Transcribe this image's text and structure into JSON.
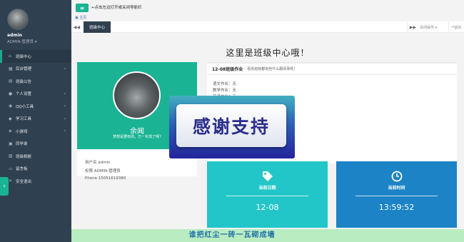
{
  "user": {
    "name": "admin",
    "role": "ADMIN-管理员"
  },
  "sidebar": {
    "items": [
      {
        "label": "班级中心",
        "icon": "home-icon",
        "glyph": "⌂",
        "caret": ""
      },
      {
        "label": "后台管理",
        "icon": "grid-icon",
        "glyph": "▦",
        "caret": "‹"
      },
      {
        "label": "班级公告",
        "icon": "bell-icon",
        "glyph": "▤",
        "caret": ""
      },
      {
        "label": "个人设置",
        "icon": "user-icon",
        "glyph": "●",
        "caret": "‹"
      },
      {
        "label": "QQ小工具",
        "icon": "qq-icon",
        "glyph": "◉",
        "caret": "‹"
      },
      {
        "label": "学习工具",
        "icon": "graduation-cap-icon",
        "glyph": "◆",
        "caret": "‹"
      },
      {
        "label": "小游戏",
        "icon": "gamepad-icon",
        "glyph": "◈",
        "caret": "‹"
      },
      {
        "label": "同学录",
        "icon": "book-icon",
        "glyph": "▣",
        "caret": ""
      },
      {
        "label": "班级相册",
        "icon": "image-icon",
        "glyph": "▨",
        "caret": ""
      },
      {
        "label": "留言板",
        "icon": "comment-icon",
        "glyph": "▭",
        "caret": ""
      },
      {
        "label": "安全退出",
        "icon": "close-icon",
        "glyph": "✕",
        "caret": ""
      }
    ]
  },
  "topbar": {
    "menu_hint": "←点击左边打开或关闭导航栏",
    "home_crumb": "主页"
  },
  "tabs": {
    "active": "班级中心",
    "ops": "关闭操作 ▾",
    "exit": "退出"
  },
  "page": {
    "title": "这里是班级中心哦！"
  },
  "profile_card": {
    "name": "余闻",
    "motto": "梦想是要有的，万一实现了呢?",
    "username_line": "用户名 admin",
    "role_line": "权限  ADMIN-管理员",
    "phone_line": "Phone 15051619380"
  },
  "homework": {
    "title": "12-08班级作业",
    "subtitle": "看看班级都有些什么翻译事呢!",
    "lines": [
      "语文作业：无",
      "数学作业：无",
      "英语作业：无"
    ]
  },
  "overlay": {
    "text": "感谢支持"
  },
  "tiles": {
    "date": {
      "label": "当前日期",
      "value": "12-08"
    },
    "time": {
      "label": "当前时间",
      "value": "13:59:52"
    }
  },
  "footer": {
    "text": "谁把红尘一砖一瓦砌成墙"
  },
  "colors": {
    "sidebar": "#2f4050",
    "accent": "#1ab394",
    "tile_date": "#23c6c8",
    "tile_time": "#1c84c6"
  }
}
